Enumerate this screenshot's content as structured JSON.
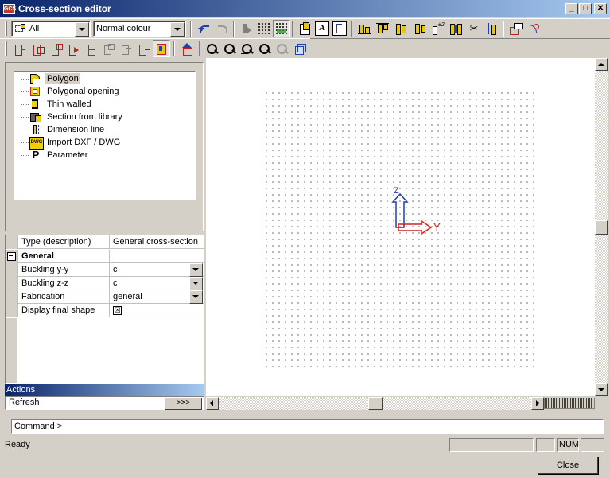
{
  "window": {
    "app_icon": "GCS",
    "title": "Cross-section editor",
    "controls": [
      "_",
      "□",
      "✕"
    ]
  },
  "toolbar": {
    "filter_combo": {
      "value": "All"
    },
    "colour_combo": {
      "value": "Normal colour"
    }
  },
  "tree": {
    "items": [
      {
        "label": "Polygon",
        "icon": "polygon-icon",
        "selected": true
      },
      {
        "label": "Polygonal opening",
        "icon": "polygonal-opening-icon"
      },
      {
        "label": "Thin walled",
        "icon": "thin-walled-icon"
      },
      {
        "label": "Section from library",
        "icon": "library-icon"
      },
      {
        "label": "Dimension line",
        "icon": "dimension-line-icon"
      },
      {
        "label": "Import DXF / DWG",
        "icon": "dwg-icon",
        "icon_text": "DWG"
      },
      {
        "label": "Parameter",
        "icon": "parameter-icon",
        "icon_text": "P"
      }
    ]
  },
  "properties": {
    "type_label": "Type (description)",
    "type_value": "General cross-section",
    "group_label": "General",
    "rows": [
      {
        "name": "Buckling y-y",
        "value": "c"
      },
      {
        "name": "Buckling z-z",
        "value": "c"
      },
      {
        "name": "Fabrication",
        "value": "general"
      }
    ],
    "display_final_shape": {
      "name": "Display final shape",
      "checked": "☒"
    }
  },
  "actions": {
    "header": "Actions",
    "refresh_label": "Refresh",
    "refresh_button": ">>>"
  },
  "canvas": {
    "axis_z_label": "Z",
    "axis_y_label": "Y",
    "axis_z_color": "#1f3fa8",
    "axis_y_color": "#d02020"
  },
  "command": {
    "prompt": "Command >"
  },
  "status": {
    "text": "Ready",
    "num": "NUM"
  },
  "footer": {
    "close_label": "Close"
  }
}
